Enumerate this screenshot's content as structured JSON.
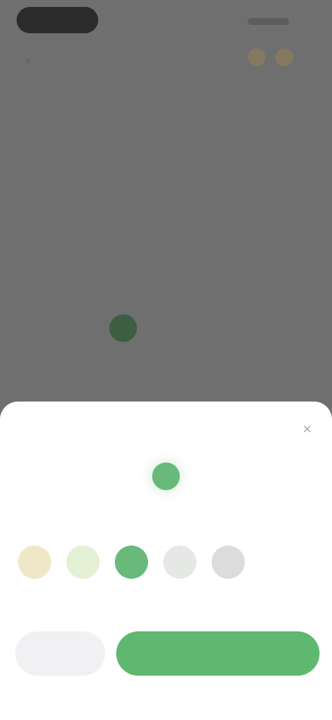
{
  "status_bar": {
    "time": ""
  },
  "background": {
    "title": ""
  },
  "sheet": {
    "title": "",
    "close_glyph": "×",
    "section_label": "",
    "selected_color": "#69b97a",
    "swatches": [
      {
        "name": "swatch-cream",
        "color": "#efe7c7"
      },
      {
        "name": "swatch-light-green",
        "color": "#e3f0d4"
      },
      {
        "name": "swatch-green",
        "color": "#69b97a"
      },
      {
        "name": "swatch-light-gray",
        "color": "#e6e8e6"
      },
      {
        "name": "swatch-gray",
        "color": "#dcdcdc"
      }
    ],
    "cancel_label": "",
    "confirm_label": ""
  },
  "colors": {
    "accent": "#5fb86f",
    "overlay": "#6f6f6f"
  }
}
